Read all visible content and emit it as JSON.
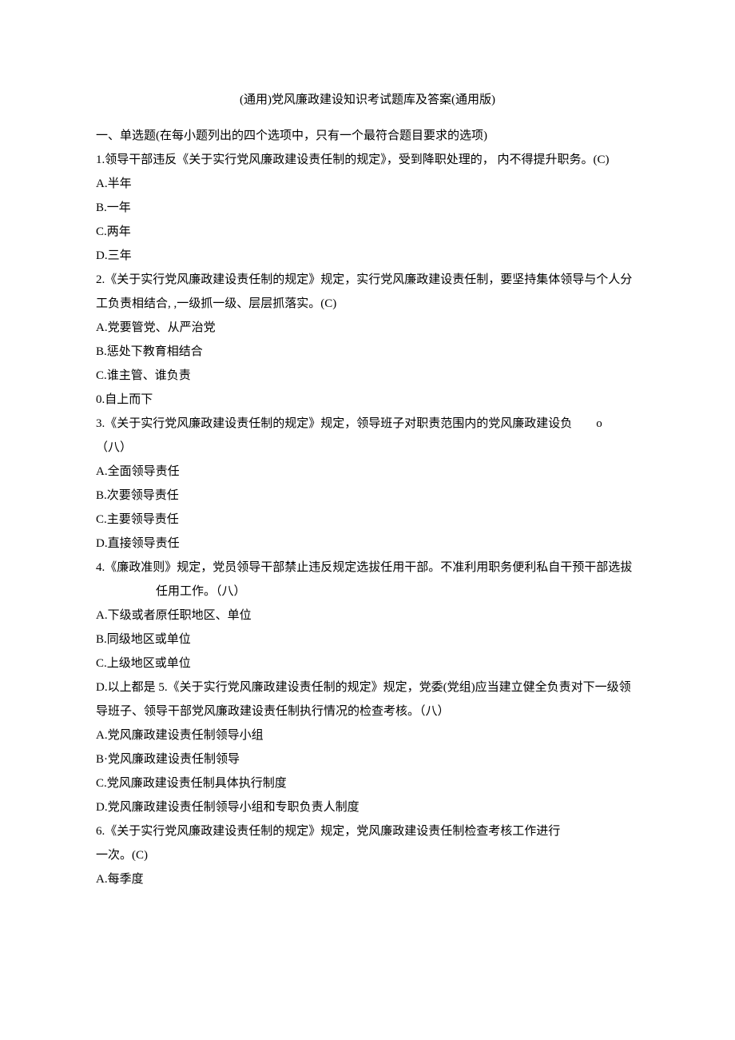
{
  "title": "(通用)党风廉政建设知识考试题库及答案(通用版)",
  "section_header": "一、单选题(在每小题列出的四个选项中，只有一个最符合题目要求的选项)",
  "q1": {
    "text": "1.领导干部违反《关于实行党风廉政建设责任制的规定》，受到降职处理的， 内不得提升职务。(C)",
    "a": "A.半年",
    "b": "B.一年",
    "c": "C.两年",
    "d": "D.三年"
  },
  "q2": {
    "text": "2.《关于实行党风廉政建设责任制的规定》规定，实行党风廉政建设责任制，要坚持集体领导与个人分工负责相结合, ,一级抓一级、层层抓落实。(C)",
    "a": "A.党要管党、从严治党",
    "b": "B.惩处下教育相结合",
    "c": "C.谁主管、谁负责",
    "d": "0.自上而下"
  },
  "q3": {
    "line1": "3.《关于实行党风廉政建设责任制的规定》规定，领导班子对职责范围内的党风廉政建设负",
    "u": "o",
    "line2": "（八）",
    "a": "A.全面领导责任",
    "b": "B.次要领导责任",
    "c": "C.主要领导责任",
    "d": "D.直接领导责任"
  },
  "q4": {
    "text": "4.《廉政准则》规定，党员领导干部禁止违反规定选拔任用干部。不准利用职务便利私自干预干部选拔",
    "text2": "任用工作。（八）",
    "a": "A.下级或者原任职地区、单位",
    "b": "B.同级地区或单位",
    "c": "C.上级地区或单位"
  },
  "q5": {
    "text": "D.以上都是 5.《关于实行党风廉政建设责任制的规定》规定，党委(党组)应当建立健全负责对下一级领导班子、领导干部党风廉政建设责任制执行情况的检查考核。（八）",
    "a": "A.党风廉政建设责任制领导小组",
    "b": "B·党风廉政建设责任制领导",
    "c": "C.党风廉政建设责任制具体执行制度",
    "d": "D.党风廉政建设责任制领导小组和专职负责人制度"
  },
  "q6": {
    "text": "6.《关于实行党风廉政建设责任制的规定》规定，党风廉政建设责任制检查考核工作进行",
    "text2": "一次。(C)",
    "a": "A.每季度"
  }
}
